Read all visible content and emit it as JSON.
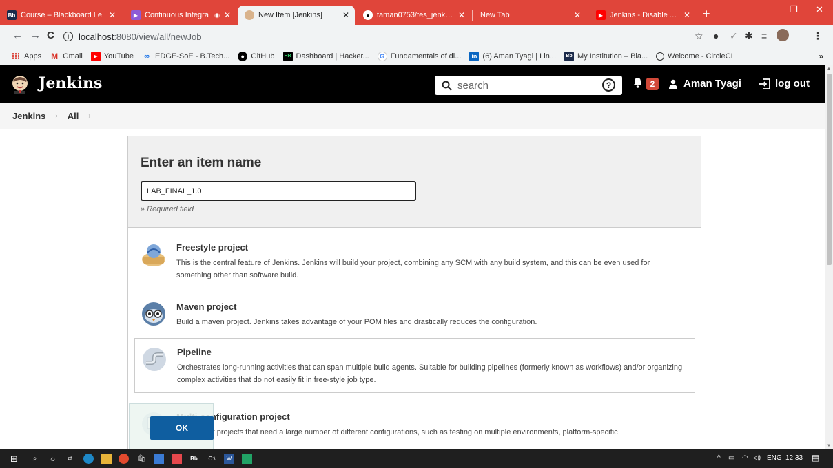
{
  "browser": {
    "tabs": [
      {
        "title": "Course – Blackboard Le",
        "icon": "blackboard-icon",
        "active": false
      },
      {
        "title": "Continuous Integra",
        "icon": "continuous-integration-icon",
        "active": false
      },
      {
        "title": "New Item [Jenkins]",
        "icon": "jenkins-icon",
        "active": true
      },
      {
        "title": "taman0753/tes_jenkins",
        "icon": "github-icon",
        "active": false
      },
      {
        "title": "New Tab",
        "icon": "",
        "active": false
      },
      {
        "title": "Jenkins - Disable Authe",
        "icon": "youtube-icon",
        "active": false
      }
    ],
    "url_host": "localhost",
    "url_path": ":8080/view/all/newJob",
    "bookmarks": [
      {
        "label": "Apps",
        "icon": "apps-grid-icon"
      },
      {
        "label": "Gmail",
        "icon": "gmail-icon"
      },
      {
        "label": "YouTube",
        "icon": "youtube-icon"
      },
      {
        "label": "EDGE-SoE - B.Tech...",
        "icon": "edge-soe-icon"
      },
      {
        "label": "GitHub",
        "icon": "github-icon"
      },
      {
        "label": "Dashboard | Hacker...",
        "icon": "hackerrank-icon"
      },
      {
        "label": "Fundamentals of di...",
        "icon": "google-icon"
      },
      {
        "label": "(6) Aman Tyagi | Lin...",
        "icon": "linkedin-icon"
      },
      {
        "label": "My Institution – Bla...",
        "icon": "blackboard-icon"
      },
      {
        "label": "Welcome - CircleCI",
        "icon": "circleci-icon"
      }
    ]
  },
  "jenkins": {
    "title": "Jenkins",
    "search_placeholder": "search",
    "notification_count": "2",
    "user_name": "Aman Tyagi",
    "logout_label": "log out",
    "breadcrumb": [
      "Jenkins",
      "All"
    ]
  },
  "form": {
    "heading": "Enter an item name",
    "item_name_value": "LAB_FINAL_1.0",
    "required_note": "» Required field",
    "ok_label": "OK"
  },
  "item_types": [
    {
      "name": "Freestyle project",
      "description": "This is the central feature of Jenkins. Jenkins will build your project, combining any SCM with any build system, and this can be even used for something other than software build.",
      "icon": "freestyle-project-icon"
    },
    {
      "name": "Maven project",
      "description": "Build a maven project. Jenkins takes advantage of your POM files and drastically reduces the configuration.",
      "icon": "maven-project-icon"
    },
    {
      "name": "Pipeline",
      "description": "Orchestrates long-running activities that can span multiple build agents. Suitable for building pipelines (formerly known as workflows) and/or organizing complex activities that do not easily fit in free-style job type.",
      "icon": "pipeline-icon",
      "selected": true
    },
    {
      "name": "Multi-configuration project",
      "description": "Suitable for projects that need a large number of different configurations, such as testing on multiple environments, platform-specific",
      "icon": "multi-configuration-icon"
    }
  ],
  "taskbar": {
    "language": "ENG",
    "time": "12:33"
  },
  "colors": {
    "tabstrip": "#e0453a",
    "jenkins_header": "#000000",
    "ok_button": "#0f5ea0",
    "badge": "#d24939"
  }
}
